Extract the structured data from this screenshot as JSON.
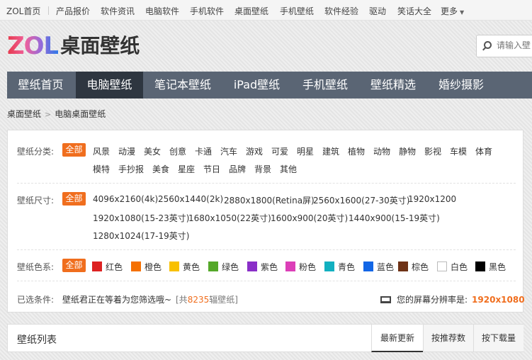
{
  "topbar": {
    "links": [
      "ZOL首页",
      "产品报价",
      "软件资讯",
      "电脑软件",
      "手机软件",
      "桌面壁纸",
      "手机壁纸",
      "软件经验",
      "驱动",
      "笑话大全",
      "更多"
    ],
    "more_caret_icon": "caret-down-icon"
  },
  "header": {
    "logo_zol": "ZOL",
    "logo_site": "桌面壁纸",
    "search_placeholder": "请输入壁",
    "search_icon": "search-icon"
  },
  "nav": {
    "items": [
      "壁纸首页",
      "电脑壁纸",
      "笔记本壁纸",
      "iPad壁纸",
      "手机壁纸",
      "壁纸精选",
      "婚纱摄影"
    ],
    "active_index": 1
  },
  "breadcrumb": {
    "items": [
      "桌面壁纸",
      "电脑桌面壁纸"
    ],
    "separator": ">"
  },
  "filters": {
    "category": {
      "label": "壁纸分类:",
      "all": "全部",
      "options": [
        "风景",
        "动漫",
        "美女",
        "创意",
        "卡通",
        "汽车",
        "游戏",
        "可爱",
        "明星",
        "建筑",
        "植物",
        "动物",
        "静物",
        "影视",
        "车模",
        "体育",
        "模特",
        "手抄报",
        "美食",
        "星座",
        "节日",
        "品牌",
        "背景",
        "其他"
      ]
    },
    "size": {
      "label": "壁纸尺寸:",
      "all": "全部",
      "options": [
        "4096x2160(4k)",
        "2560x1440(2k)",
        "2880x1800(Retina屏)",
        "2560x1600(27-30英寸)",
        "1920x1200",
        "1920x1080(15-23英寸)",
        "1680x1050(22英寸)",
        "1600x900(20英寸)",
        "1440x900(15-19英寸)",
        "1280x1024(17-19英寸)"
      ]
    },
    "color": {
      "label": "壁纸色系:",
      "all": "全部",
      "options": [
        {
          "name": "红色",
          "hex": "#dd2222"
        },
        {
          "name": "橙色",
          "hex": "#f57000"
        },
        {
          "name": "黄色",
          "hex": "#f8c000"
        },
        {
          "name": "绿色",
          "hex": "#55a82a"
        },
        {
          "name": "紫色",
          "hex": "#8a2fc8"
        },
        {
          "name": "粉色",
          "hex": "#dc3fb8"
        },
        {
          "name": "青色",
          "hex": "#12b0c0"
        },
        {
          "name": "蓝色",
          "hex": "#1266e6"
        },
        {
          "name": "棕色",
          "hex": "#6e3216"
        },
        {
          "name": "白色",
          "hex": "#ffffff"
        },
        {
          "name": "黑色",
          "hex": "#000000"
        }
      ]
    },
    "selected": {
      "label": "已选条件:",
      "text": "壁纸君正在等着为您筛选哦~",
      "count_prefix": "[共",
      "count": "8235",
      "count_suffix": "辐壁纸]",
      "screen_label": "您的屏幕分辨率是:",
      "screen_icon": "monitor-icon",
      "resolution": "1920x1080"
    }
  },
  "list": {
    "title": "壁纸列表",
    "tabs": [
      "最新更新",
      "按推荐数",
      "按下载量"
    ],
    "active_tab": 0
  },
  "colors": {
    "accent": "#f06e1e",
    "nav_bg": "#5a6574",
    "nav_active": "#2e3640"
  }
}
